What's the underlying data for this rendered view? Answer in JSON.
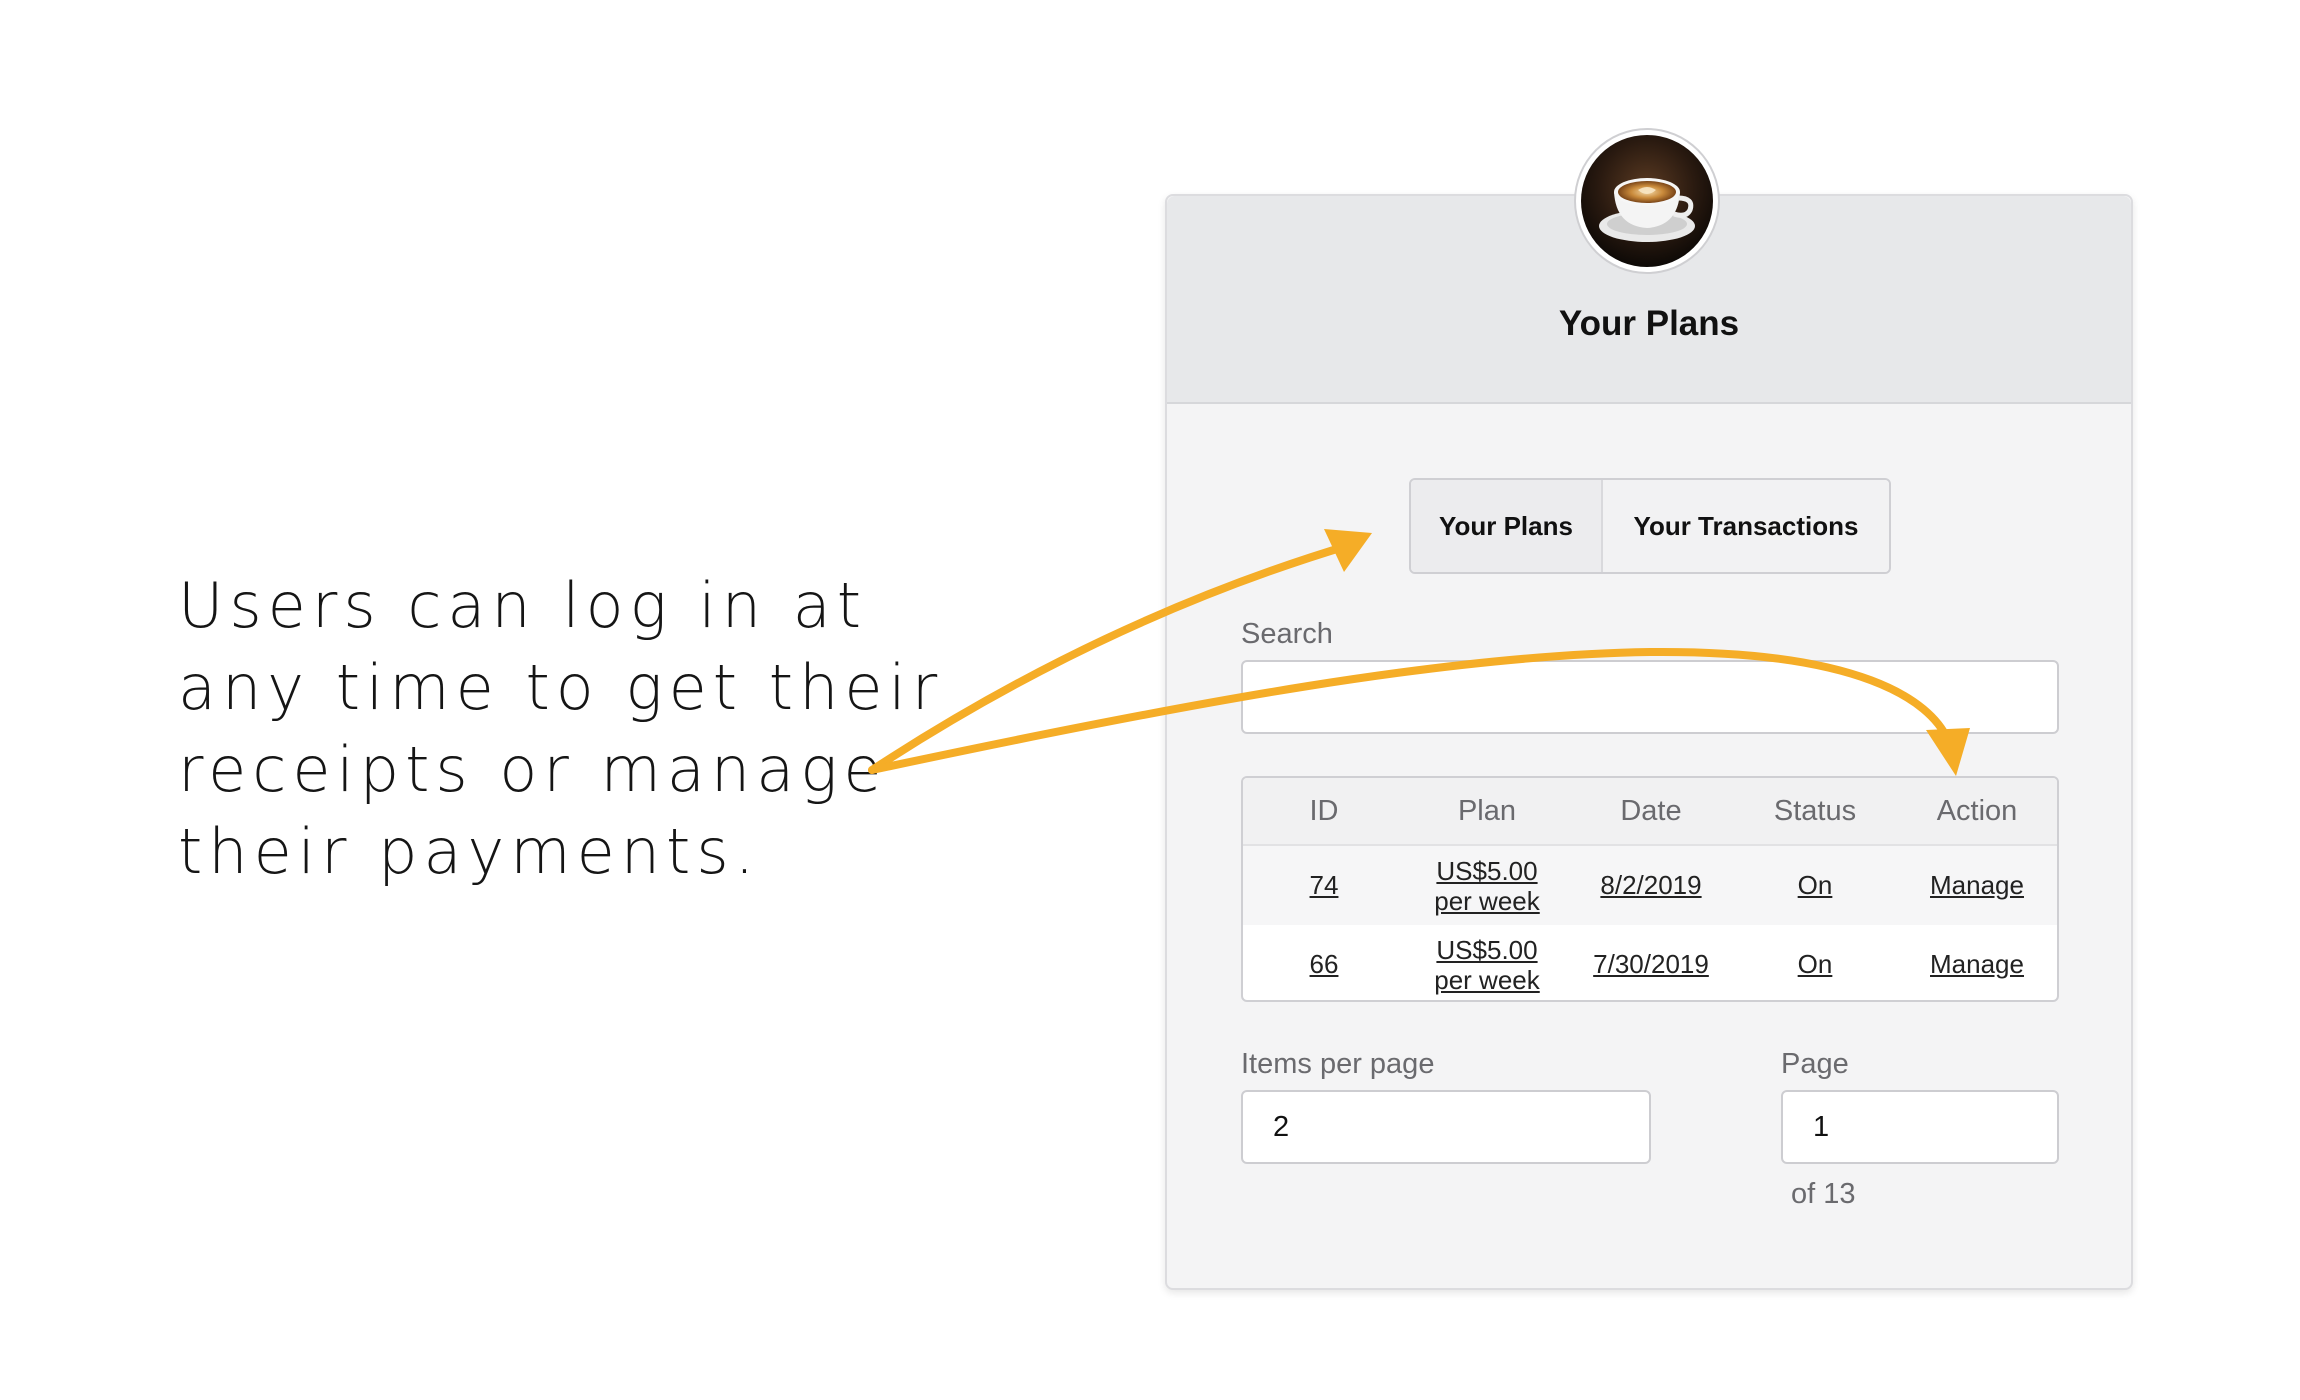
{
  "annotation": {
    "lines": [
      "Users can log in at",
      "any time to get their",
      "receipts or manage",
      "their payments."
    ],
    "arrow_color": "#f5ad27"
  },
  "card": {
    "title": "Your Plans",
    "avatar_icon": "coffee-cup-icon",
    "tabs": [
      {
        "label": "Your Plans",
        "active": true
      },
      {
        "label": "Your Transactions",
        "active": false
      }
    ],
    "search": {
      "label": "Search",
      "value": "",
      "placeholder": ""
    },
    "table": {
      "columns": [
        "ID",
        "Plan",
        "Date",
        "Status",
        "Action"
      ],
      "rows": [
        {
          "id": "74",
          "plan_line1": "US$5.00",
          "plan_line2": "per week",
          "date": "8/2/2019",
          "status": "On",
          "action": "Manage"
        },
        {
          "id": "66",
          "plan_line1": "US$5.00",
          "plan_line2": "per week",
          "date": "7/30/2019",
          "status": "On",
          "action": "Manage"
        }
      ]
    },
    "items_per_page": {
      "label": "Items per page",
      "value": "2"
    },
    "page": {
      "label": "Page",
      "value": "1",
      "of_text": "of 13"
    }
  }
}
